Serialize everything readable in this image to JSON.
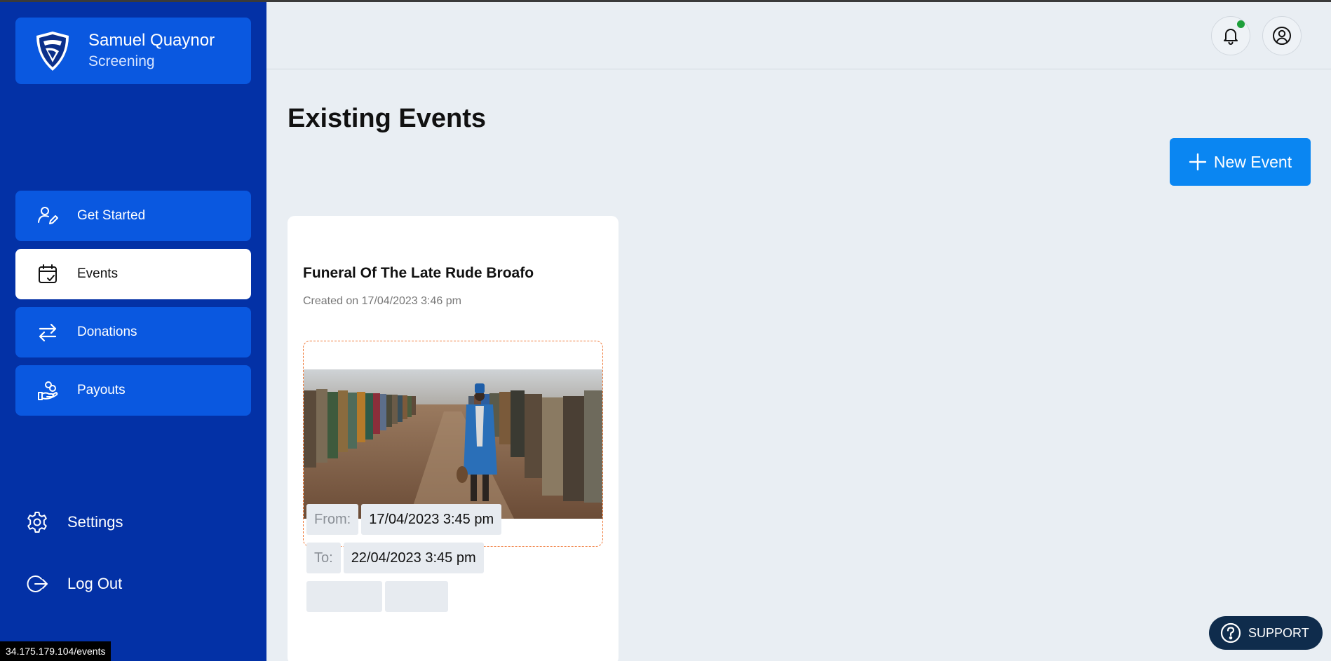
{
  "sidebar": {
    "profile": {
      "name": "Samuel Quaynor",
      "role": "Screening"
    },
    "nav": [
      {
        "label": "Get Started",
        "icon": "user-edit-icon"
      },
      {
        "label": "Events",
        "icon": "calendar-check-icon",
        "active": true
      },
      {
        "label": "Donations",
        "icon": "transfer-arrows-icon"
      },
      {
        "label": "Payouts",
        "icon": "hand-coins-icon"
      }
    ],
    "settings_label": "Settings",
    "logout_label": "Log Out"
  },
  "header": {
    "notification_icon": "bell-icon",
    "notification_dot_color": "#1d9f3a",
    "account_icon": "user-circle-icon"
  },
  "main": {
    "title": "Existing Events",
    "new_event_label": "New Event",
    "event_card": {
      "title": "Funeral Of The Late Rude Broafo",
      "created": "Created on 17/04/2023 3:46 pm",
      "from_label": "From:",
      "from_value": "17/04/2023 3:45 pm",
      "to_label": "To:",
      "to_value": "22/04/2023 3:45 pm"
    }
  },
  "status_bar": {
    "url": "34.175.179.104/events"
  },
  "support": {
    "label": "SUPPORT"
  },
  "colors": {
    "sidebar": "#0331a6",
    "nav_item": "#0a58e0",
    "accent": "#0a86f2",
    "background": "#e9eef3",
    "support": "#0f2c4c"
  }
}
